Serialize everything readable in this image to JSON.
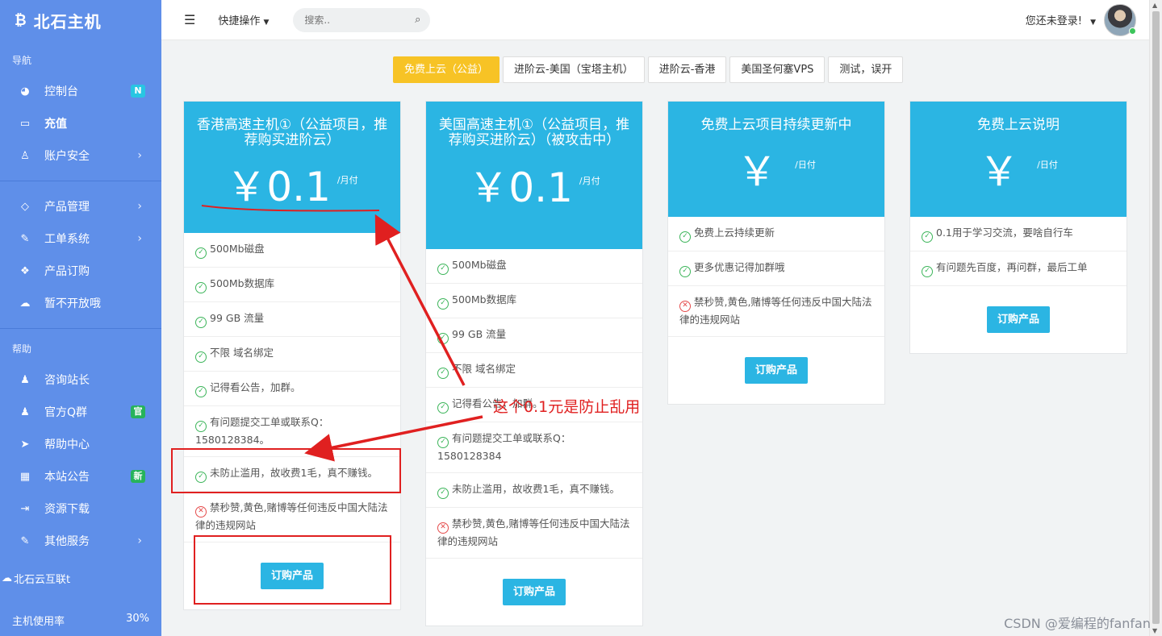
{
  "brand": {
    "name": "北石主机",
    "logo_icon": "bitcoin-icon"
  },
  "sidebar": {
    "nav_title": "导航",
    "nav_items": [
      {
        "label": "控制台",
        "icon": "dashboard-icon",
        "badge": "N"
      },
      {
        "label": "充值",
        "icon": "card-icon"
      },
      {
        "label": "账户安全",
        "icon": "user-icon",
        "arrow": "›"
      }
    ],
    "product_items": [
      {
        "label": "产品管理",
        "icon": "diamond-icon",
        "arrow": "›"
      },
      {
        "label": "工单系统",
        "icon": "edit-icon",
        "arrow": "›"
      },
      {
        "label": "产品订购",
        "icon": "dropbox-icon"
      },
      {
        "label": "暂不开放哦",
        "icon": "cloud-icon"
      }
    ],
    "help_title": "帮助",
    "help_items": [
      {
        "label": "咨询站长",
        "icon": "qq-icon"
      },
      {
        "label": "官方Q群",
        "icon": "qq-icon",
        "badge": "官"
      },
      {
        "label": "帮助中心",
        "icon": "paper-plane-icon"
      },
      {
        "label": "本站公告",
        "icon": "calendar-icon",
        "badge": "新"
      },
      {
        "label": "资源下载",
        "icon": "sign-in-icon"
      },
      {
        "label": "其他服务",
        "icon": "edit-icon",
        "arrow": "›"
      }
    ],
    "footer_link": "北石云互联t",
    "usage_label": "主机使用率",
    "usage_value": "30%"
  },
  "topbar": {
    "quick_label": "快捷操作",
    "search_placeholder": "搜索..",
    "login_label": "您还未登录!"
  },
  "tabs": [
    {
      "label": "免费上云（公益）",
      "active": true
    },
    {
      "label": "进阶云-美国（宝塔主机）"
    },
    {
      "label": "进阶云-香港"
    },
    {
      "label": "美国圣何塞VPS"
    },
    {
      "label": "测试，误开"
    }
  ],
  "cards": [
    {
      "title": "香港高速主机①（公益项目，推荐购买进阶云）",
      "price": "￥0.1",
      "unit": "/月付",
      "features": [
        {
          "ok": true,
          "text": "500Mb磁盘"
        },
        {
          "ok": true,
          "text": "500Mb数据库"
        },
        {
          "ok": true,
          "text": "99 GB 流量"
        },
        {
          "ok": true,
          "text": "不限 域名绑定"
        },
        {
          "ok": true,
          "text": "记得看公告，加群。"
        },
        {
          "ok": true,
          "text": "有问题提交工单或联系Q：1580128384。"
        },
        {
          "ok": true,
          "text": "未防止滥用，故收费1毛，真不赚钱。"
        },
        {
          "ok": false,
          "text": "禁秒赞,黄色,赌博等任何违反中国大陆法律的违规网站"
        }
      ],
      "button": "订购产品"
    },
    {
      "title": "美国高速主机①（公益项目，推荐购买进阶云）（被攻击中）",
      "price": "￥0.1",
      "unit": "/月付",
      "features": [
        {
          "ok": true,
          "text": "500Mb磁盘"
        },
        {
          "ok": true,
          "text": "500Mb数据库"
        },
        {
          "ok": true,
          "text": "99 GB 流量"
        },
        {
          "ok": true,
          "text": "不限 域名绑定"
        },
        {
          "ok": true,
          "text": "记得看公告，加群。"
        },
        {
          "ok": true,
          "text": "有问题提交工单或联系Q：1580128384"
        },
        {
          "ok": true,
          "text": "未防止滥用，故收费1毛，真不赚钱。"
        },
        {
          "ok": false,
          "text": "禁秒赞,黄色,赌博等任何违反中国大陆法律的违规网站"
        }
      ],
      "button": "订购产品"
    },
    {
      "title": "免费上云项目持续更新中",
      "price": "￥",
      "unit": "/日付",
      "features": [
        {
          "ok": true,
          "text": "免费上云持续更新"
        },
        {
          "ok": true,
          "text": "更多优惠记得加群哦"
        },
        {
          "ok": false,
          "text": "禁秒赞,黄色,赌博等任何违反中国大陆法律的违规网站"
        }
      ],
      "button": "订购产品"
    },
    {
      "title": "免费上云说明",
      "price": "￥",
      "unit": "/日付",
      "features": [
        {
          "ok": true,
          "text": "0.1用于学习交流，要啥自行车"
        },
        {
          "ok": true,
          "text": "有问题先百度，再问群，最后工单"
        }
      ],
      "button": "订购产品"
    }
  ],
  "annotation": "这个0.1元是防止乱用",
  "watermark": "CSDN @爱编程的fanfan",
  "colors": {
    "sidebar": "#5f8fe9",
    "card_head": "#2bb5e3",
    "tab_active": "#f7c325",
    "annotation": "#e02020"
  }
}
